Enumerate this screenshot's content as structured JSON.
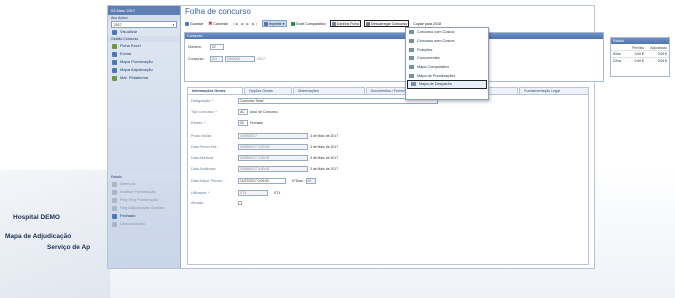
{
  "background": {
    "line1": "Hospital DEMO",
    "line2": "Mapa de Adjudicação",
    "line3": "Serviço de Ap"
  },
  "sidebar": {
    "header": "03 Maio 2017",
    "section1_label": "Ano Activo",
    "year_value": "2017",
    "item_visualizar": "Visualizar",
    "section2_label": "Gestão Concurso",
    "item_ficha_excel": "Ficha Excel",
    "item_enviar": "Enviar",
    "item_mapa_ponderacao": "Mapa Ponderação",
    "item_mapa_adjudicacao": "Mapa Adjudicação",
    "item_mat_plataforma": "Mat. Plataforma",
    "section3_label": "Estado",
    "item_abertura": "Abertura",
    "item_analise_ponderacao": "Análise Ponderação",
    "item_reg_ponderacao": "Reg Reg Ponderação",
    "item_reg_adjudicacao": "Reg Adjudicação Análise",
    "item_fechado": "Fechado",
    "item_desconhecido": "Desconhecido"
  },
  "main": {
    "title": "Folha de concurso",
    "toolbar": {
      "guardar": "Guardar",
      "cancelar": "Cancelar",
      "nav": "|◀ ◀ ▶ ▶|",
      "imprimir": "Imprimir",
      "excel": "Excel Comparativo",
      "ganhos": "Ganhos Ficha",
      "descarregar": "Descarregar Concurso",
      "copiar": "Copiar para 2018"
    },
    "concurso_panel": {
      "header": "Concurso",
      "numero_label": "Número:",
      "numero_value": "22",
      "concurso_label": "Concurso:",
      "concurso_code": "DO",
      "concurso_num": "0000000",
      "concurso_year": "2017",
      "note_line1": "estado, só pode alterar o",
      "note_line2": "servações não passa em estado",
      "note_line3": "rados"
    },
    "estado_panel": {
      "header": "Estado",
      "col1": "Previsto",
      "col2": "Adjudicado",
      "row1_label": "S/Iva",
      "row1_v1": "0,00 €",
      "row1_v2": "0,00 €",
      "row2_label": "C/Iva",
      "row2_v1": "0,00 €",
      "row2_v2": "0,00 €"
    },
    "dropdown": {
      "items": [
        "Concurso com Custos",
        "Concurso sem Custos",
        "Posições",
        "Concorrentes",
        "Mapa Comparativo",
        "Mapa de Ponderações",
        "Mapa de Despacho"
      ]
    },
    "tabs": [
      "Informações Gerais",
      "Opções Gerais",
      "Observações",
      "Documentos / Fornecedores",
      "Ponderações",
      "Fundamentação Legal"
    ],
    "form": {
      "designacao_label": "Designação: *",
      "designacao_value": "Concurso Teste",
      "tipo_label": "Tipo concurso: *",
      "tipo_code": "AC",
      "tipo_desc": "Aval. de Concurso",
      "estado_label": "Estado: *",
      "estado_code": "30",
      "estado_desc": "Fechado",
      "prazo_label": "Prazo Inicial:",
      "prazo_value": "03/05/2017",
      "prazo_note": "3 de Maio de 2017",
      "fecho_label": "Data Fecho Ent.:",
      "fecho_value": "03/05/2017 0:00:00",
      "fecho_note": "3 de Maio de 2017",
      "abertura_label": "Data Abertura:",
      "abertura_value": "03/05/2017 0:00:00",
      "abertura_note": "3 de Maio de 2017",
      "audiencia_label": "Data Audiência:",
      "audiencia_value": "03/05/2017 0:00:00",
      "audiencia_note": "3 de Maio de 2017",
      "adjud_label": "Data Adjud. Previst.:",
      "adjud_value": "11/07/2017 0:00:00",
      "adjud_extra_label": "N°Dias:",
      "adjud_extra_value": "69",
      "utilizador_label": "Utilizador: *",
      "utilizador_value": "ST4",
      "utilizador_desc": "ST4",
      "ativado_label": "Ativado:"
    }
  }
}
